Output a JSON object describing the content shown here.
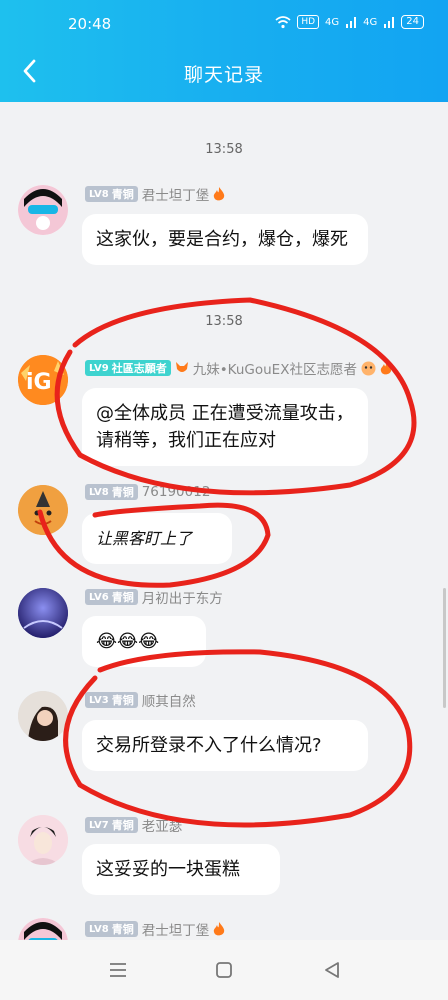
{
  "status_bar": {
    "time": "20:48",
    "hd": "HD",
    "net1": "4G",
    "net2": "4G",
    "battery": "24"
  },
  "header": {
    "title": "聊天记录"
  },
  "timestamps": [
    "13:58",
    "13:58"
  ],
  "messages": [
    {
      "level": "LV8",
      "rank": "青铜",
      "name": "君士坦丁堡",
      "text": "这家伙，要是合约，爆仓，爆死"
    },
    {
      "level": "LV9",
      "rank": "社區志願者",
      "name": "九妹•KuGouEX社区志愿者",
      "text": "@全体成员 正在遭受流量攻击，请稍等，我们正在应对"
    },
    {
      "level": "LV8",
      "rank": "青铜",
      "name": "76190012",
      "text": "让黑客盯上了"
    },
    {
      "level": "LV6",
      "rank": "青铜",
      "name": "月初出于东方",
      "text": "😂😂😂"
    },
    {
      "level": "LV3",
      "rank": "青铜",
      "name": "顺其自然",
      "text": "交易所登录不入了什么情况?"
    },
    {
      "level": "LV7",
      "rank": "青铜",
      "name": "老亚瑟",
      "text": "这妥妥的一块蛋糕"
    },
    {
      "level": "LV8",
      "rank": "青铜",
      "name": "君士坦丁堡",
      "text": ""
    }
  ],
  "colors": {
    "header_start": "#1ec0ee",
    "header_end": "#12a4f2",
    "annotation": "#e8231b",
    "volunteer_badge": "#3ed3cf",
    "rank_badge": "#b9c2cf",
    "background": "#f1f2f4"
  },
  "icons": {
    "back": "chevron-left-icon",
    "fire": "fire-icon",
    "fox": "fox-icon",
    "menu": "menu-icon",
    "home": "square-icon",
    "nav_back": "triangle-back-icon"
  }
}
